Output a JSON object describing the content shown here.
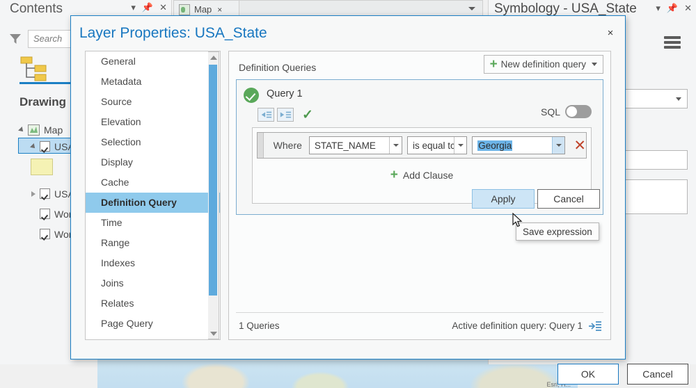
{
  "app": {
    "contents_pane": {
      "title": "Contents",
      "header_icons": [
        "chevron-down-icon",
        "pin-icon",
        "close-icon"
      ],
      "search_placeholder": "Search",
      "section_label": "Drawing",
      "tree": [
        {
          "label": "Map",
          "indent": 0,
          "has_checkbox": false,
          "expander": "expanded",
          "icon": "map-icon"
        },
        {
          "label": "USA_S",
          "indent": 1,
          "has_checkbox": true,
          "expander": "expanded",
          "selected": true
        },
        {
          "label": "USA C",
          "indent": 1,
          "has_checkbox": true,
          "expander": "collapsed"
        },
        {
          "label": "World",
          "indent": 1,
          "has_checkbox": true,
          "expander": "none"
        },
        {
          "label": "World",
          "indent": 1,
          "has_checkbox": true,
          "expander": "none"
        }
      ]
    },
    "map_tab": {
      "label": "Map",
      "close": "×"
    },
    "symbology_pane": {
      "title": "Symbology - USA_State",
      "header_icons": [
        "chevron-down-icon",
        "pin-icon",
        "close-icon"
      ]
    },
    "map_credit": "Esri, H..."
  },
  "dialog": {
    "title": "Layer Properties: USA_State",
    "close_label": "×",
    "sidebar_items": [
      {
        "label": "General",
        "active": false
      },
      {
        "label": "Metadata",
        "active": false
      },
      {
        "label": "Source",
        "active": false
      },
      {
        "label": "Elevation",
        "active": false
      },
      {
        "label": "Selection",
        "active": false
      },
      {
        "label": "Display",
        "active": false
      },
      {
        "label": "Cache",
        "active": false
      },
      {
        "label": "Definition Query",
        "active": true
      },
      {
        "label": "Time",
        "active": false
      },
      {
        "label": "Range",
        "active": false
      },
      {
        "label": "Indexes",
        "active": false
      },
      {
        "label": "Joins",
        "active": false
      },
      {
        "label": "Relates",
        "active": false
      },
      {
        "label": "Page Query",
        "active": false
      }
    ],
    "panel": {
      "heading": "Definition Queries",
      "new_query_button": "New definition query",
      "query": {
        "name": "Query 1",
        "status": "valid",
        "sql_label": "SQL",
        "sql_enabled": false,
        "clause": {
          "where_label": "Where",
          "field": "STATE_NAME",
          "operator": "is equal tc",
          "value": "Georgia",
          "value_selected": true,
          "delete_label": "✕"
        },
        "add_clause_label": "Add Clause",
        "apply_label": "Apply",
        "cancel_label": "Cancel"
      },
      "footer": {
        "query_count": "1 Queries",
        "active_query": "Active definition query: Query 1"
      }
    },
    "ok_label": "OK",
    "cancel_label": "Cancel"
  },
  "tooltip": {
    "text": "Save expression"
  },
  "colors": {
    "accent_blue": "#1877c0",
    "selection_blue": "#8fcaec",
    "valid_green": "#5aa85a",
    "delete_red": "#c0442b",
    "scrollbar_blue": "#5eaadd"
  }
}
